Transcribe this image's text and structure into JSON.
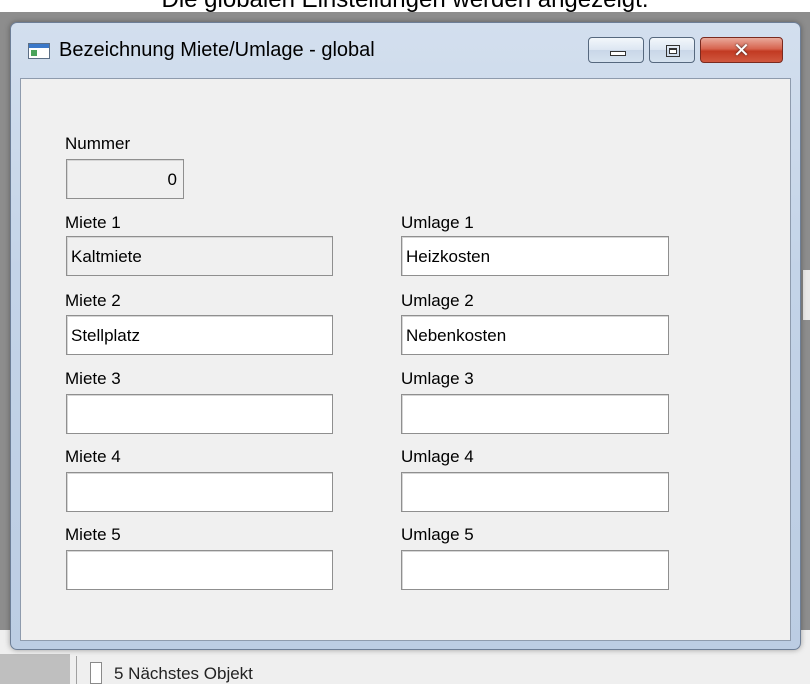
{
  "caption": "Die globalen Einstellungen werden angezeigt.",
  "window": {
    "title": "Bezeichnung Miete/Umlage - global",
    "close_glyph": "✕"
  },
  "form": {
    "nummer_label": "Nummer",
    "nummer_value": "0",
    "miete": [
      {
        "label": "Miete 1",
        "value": "Kaltmiete"
      },
      {
        "label": "Miete 2",
        "value": "Stellplatz"
      },
      {
        "label": "Miete 3",
        "value": ""
      },
      {
        "label": "Miete 4",
        "value": ""
      },
      {
        "label": "Miete 5",
        "value": ""
      }
    ],
    "umlage": [
      {
        "label": "Umlage 1",
        "value": "Heizkosten"
      },
      {
        "label": "Umlage 2",
        "value": "Nebenkosten"
      },
      {
        "label": "Umlage 3",
        "value": ""
      },
      {
        "label": "Umlage 4",
        "value": ""
      },
      {
        "label": "Umlage 5",
        "value": ""
      }
    ]
  },
  "background": {
    "list_item": "5 Nächstes Objekt"
  }
}
